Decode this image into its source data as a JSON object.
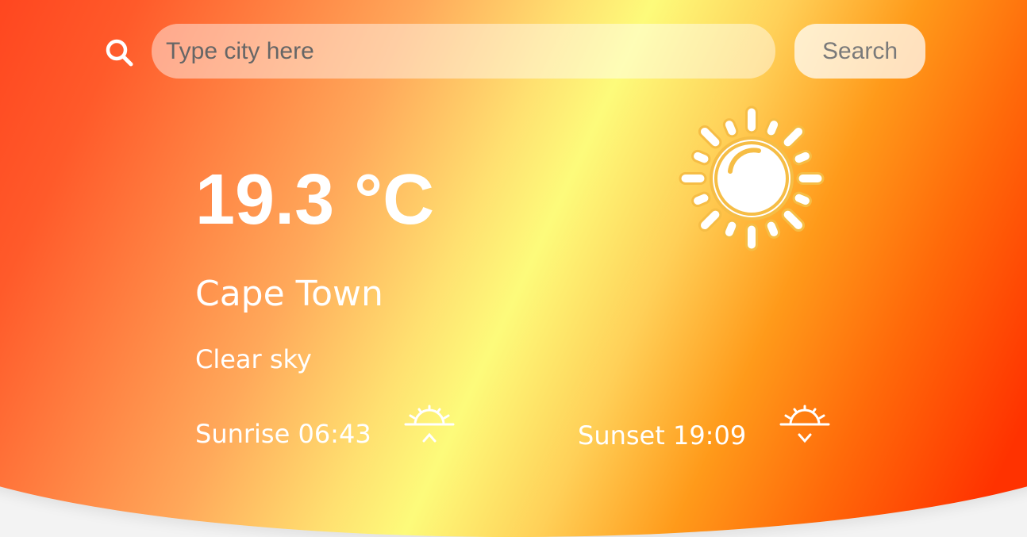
{
  "search": {
    "placeholder": "Type city here",
    "value": "",
    "button_label": "Search",
    "icon": "search-icon"
  },
  "weather": {
    "temperature": "19.3 °C",
    "city": "Cape Town",
    "description": "Clear sky",
    "icon": "sun-icon",
    "sunrise_label": "Sunrise 06:43",
    "sunrise_icon": "sunrise-icon",
    "sunset_label": "Sunset 19:09",
    "sunset_icon": "sunset-icon"
  },
  "colors": {
    "gradient_red": "#ff1e0a",
    "gradient_orange": "#ff9a1a",
    "gradient_yellow": "#fdfb7a",
    "text": "#ffffff",
    "button_text": "#7a7a7a"
  }
}
